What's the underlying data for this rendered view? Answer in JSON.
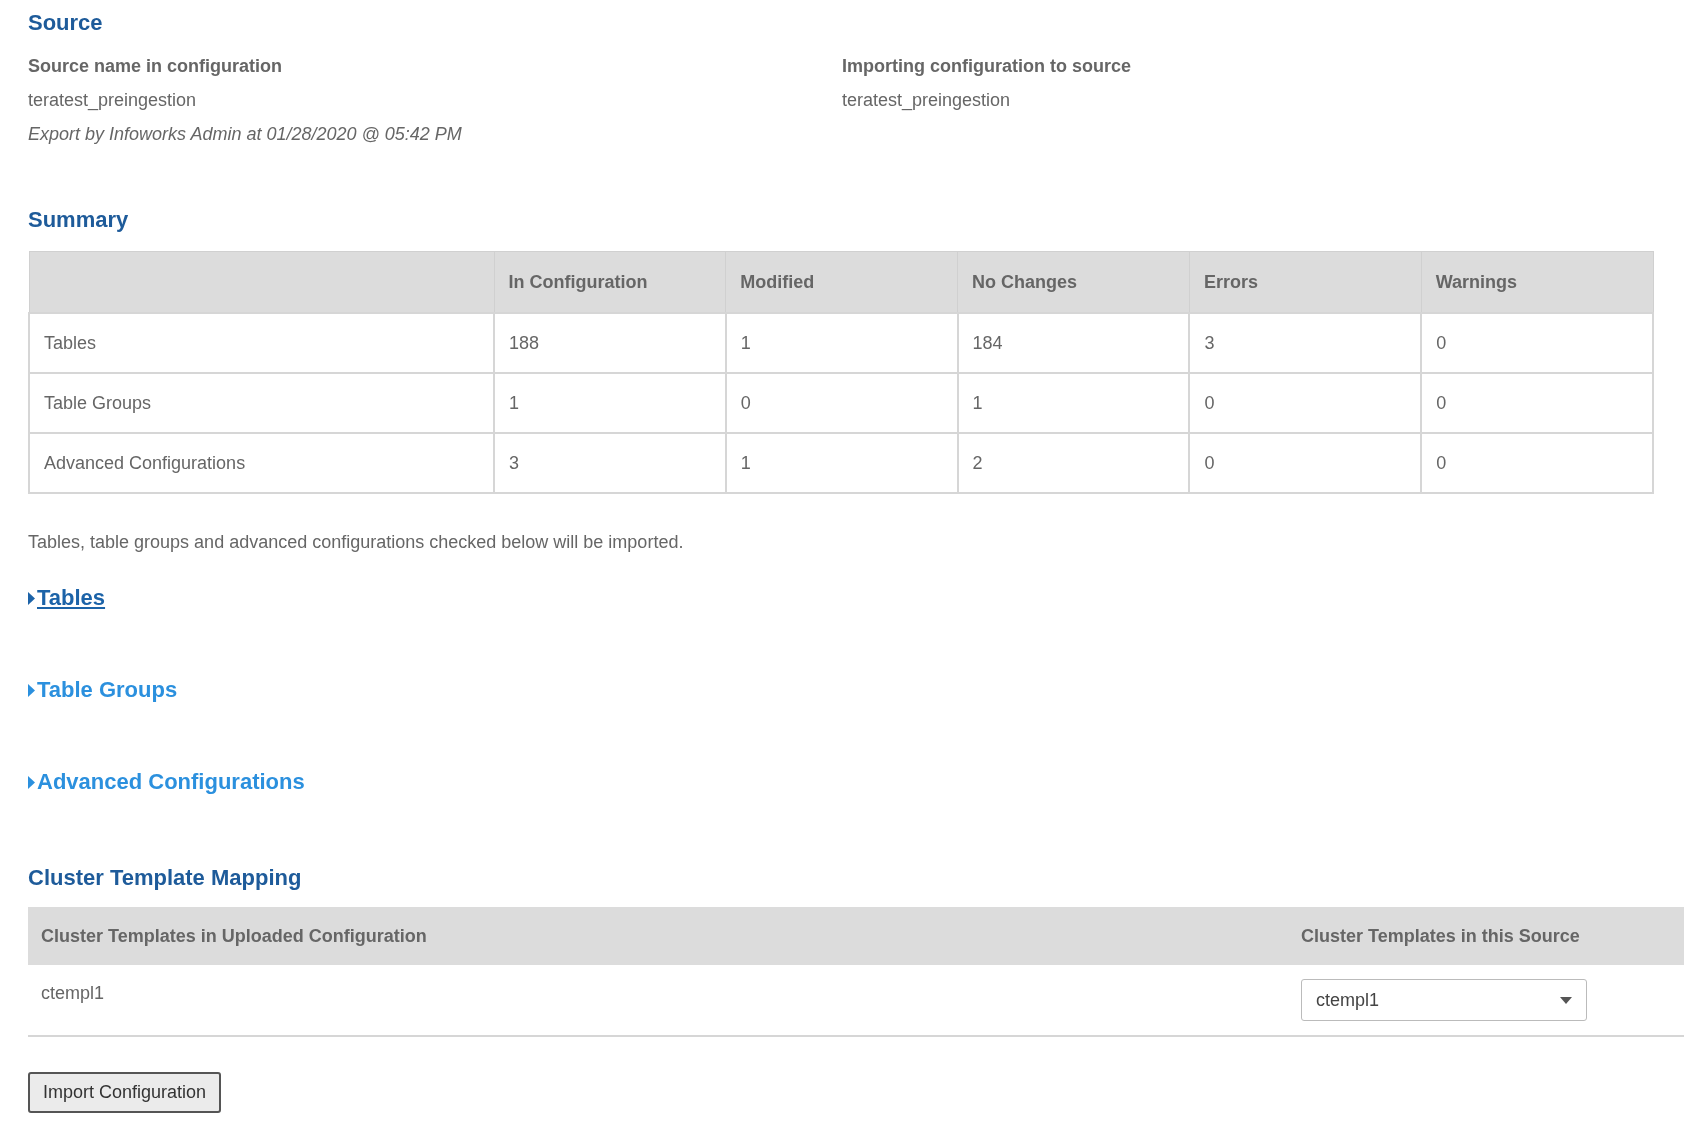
{
  "source": {
    "heading": "Source",
    "fields": [
      {
        "label": "Source name in configuration",
        "value": "teratest_preingestion",
        "note": "Export by Infoworks Admin at 01/28/2020 @ 05:42 PM"
      },
      {
        "label": "Importing configuration to source",
        "value": "teratest_preingestion"
      }
    ]
  },
  "summary": {
    "heading": "Summary",
    "columns": [
      "",
      "In Configuration",
      "Modified",
      "No Changes",
      "Errors",
      "Warnings"
    ],
    "rows": [
      [
        "Tables",
        "188",
        "1",
        "184",
        "3",
        "0"
      ],
      [
        "Table Groups",
        "1",
        "0",
        "1",
        "0",
        "0"
      ],
      [
        "Advanced Configurations",
        "3",
        "1",
        "2",
        "0",
        "0"
      ]
    ]
  },
  "note": "Tables, table groups and advanced configurations checked below will be imported.",
  "sections": [
    {
      "label": "Tables",
      "selected": true,
      "expanded": false
    },
    {
      "label": "Table Groups",
      "selected": false,
      "expanded": false
    },
    {
      "label": "Advanced Configurations",
      "selected": false,
      "expanded": false
    }
  ],
  "cluster": {
    "heading": "Cluster Template Mapping",
    "columns": [
      "Cluster Templates in Uploaded Configuration",
      "Cluster Templates in this Source"
    ],
    "rows": [
      {
        "uploaded": "ctempl1",
        "selected_template": "ctempl1"
      }
    ]
  },
  "buttons": [
    "Import Configuration"
  ]
}
